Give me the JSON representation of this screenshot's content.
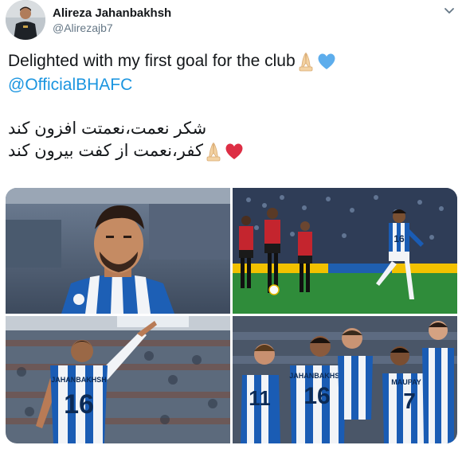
{
  "author": {
    "name": "Alireza Jahanbakhsh",
    "handle": "@Alirezajb7"
  },
  "tweet": {
    "line1": "Delighted with my first goal for the club",
    "mention": "@OfficialBHAFC",
    "persian_line1": "شکر نعمت،نعمتت افزون کند",
    "persian_line2": "کفر،نعمت از کفت بیرون کند"
  },
  "icons": [
    "caret-down-icon",
    "folded-hands-emoji",
    "blue-heart-emoji",
    "red-heart-emoji"
  ],
  "photos": [
    {
      "name": "player-closeup-photo",
      "jersey_text": ""
    },
    {
      "name": "shot-on-goal-photo",
      "jersey_text": "16"
    },
    {
      "name": "pointing-celebration-photo",
      "jersey_number": "16",
      "jersey_name": "JAHANBAKHSH"
    },
    {
      "name": "team-celebration-photo",
      "numbers": [
        "11",
        "16",
        "7"
      ],
      "names": [
        "JAHANBAKHSH",
        "MAUPAY"
      ]
    }
  ],
  "colors": {
    "mention": "#1b95e0",
    "secondary_text": "#657786",
    "brighton_blue": "#0057b8"
  }
}
